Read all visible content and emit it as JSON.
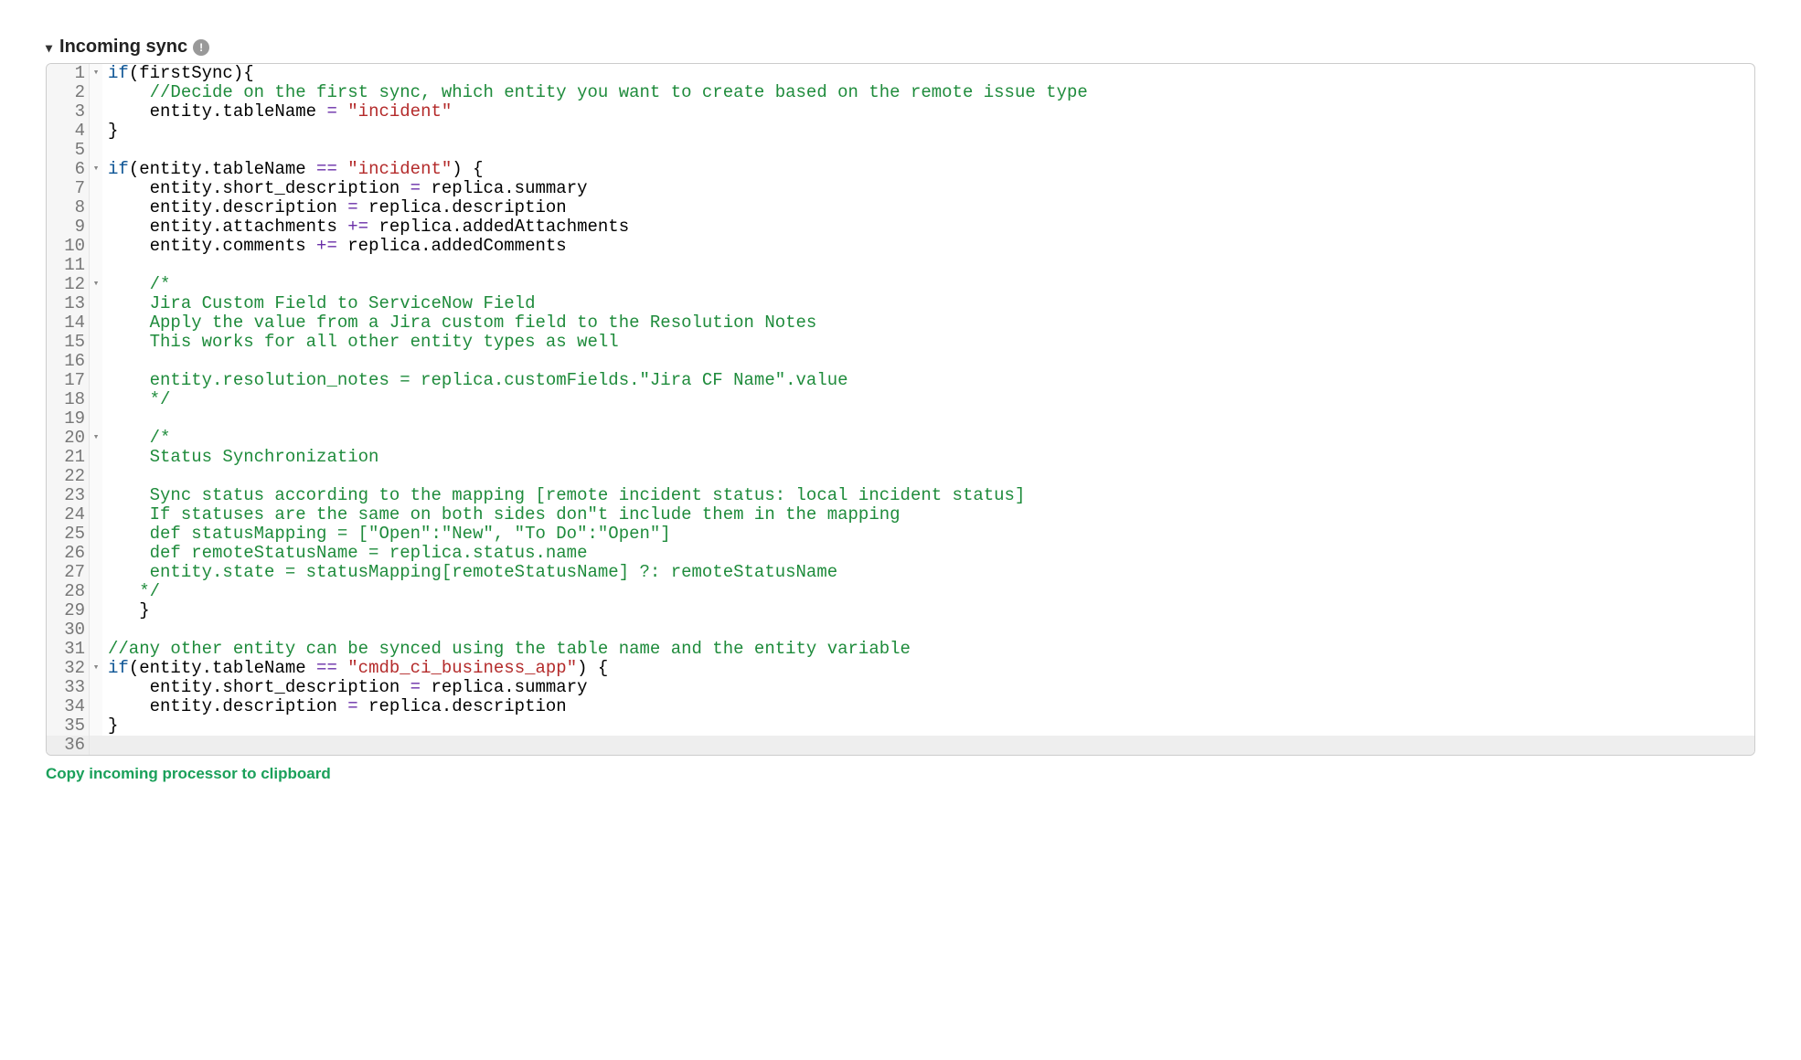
{
  "header": {
    "title": "Incoming sync",
    "info_tooltip": "info"
  },
  "footer": {
    "copy_link": "Copy incoming processor to clipboard"
  },
  "editor": {
    "lines": [
      {
        "n": "1",
        "fold": true,
        "tokens": [
          [
            "kw",
            "if"
          ],
          [
            "def",
            "(firstSync){"
          ]
        ]
      },
      {
        "n": "2",
        "tokens": [
          [
            "indent2"
          ],
          [
            "cm",
            "//Decide on the first sync, which entity you want to create based on the remote issue type"
          ]
        ]
      },
      {
        "n": "3",
        "tokens": [
          [
            "indent2"
          ],
          [
            "def",
            "entity.tableName "
          ],
          [
            "op",
            "="
          ],
          [
            "def",
            " "
          ],
          [
            "str",
            "\"incident\""
          ]
        ]
      },
      {
        "n": "4",
        "tokens": [
          [
            "def",
            "}"
          ]
        ]
      },
      {
        "n": "5",
        "tokens": []
      },
      {
        "n": "6",
        "fold": true,
        "tokens": [
          [
            "kw",
            "if"
          ],
          [
            "def",
            "(entity.tableName "
          ],
          [
            "op",
            "=="
          ],
          [
            "def",
            " "
          ],
          [
            "str",
            "\"incident\""
          ],
          [
            "def",
            ") {"
          ]
        ]
      },
      {
        "n": "7",
        "tokens": [
          [
            "indent2"
          ],
          [
            "def",
            "entity.short_description "
          ],
          [
            "op",
            "="
          ],
          [
            "def",
            " replica.summary"
          ]
        ]
      },
      {
        "n": "8",
        "tokens": [
          [
            "indent2"
          ],
          [
            "def",
            "entity.description "
          ],
          [
            "op",
            "="
          ],
          [
            "def",
            " replica.description"
          ]
        ]
      },
      {
        "n": "9",
        "tokens": [
          [
            "indent2"
          ],
          [
            "def",
            "entity.attachments "
          ],
          [
            "op",
            "+="
          ],
          [
            "def",
            " replica.addedAttachments"
          ]
        ]
      },
      {
        "n": "10",
        "tokens": [
          [
            "indent2"
          ],
          [
            "def",
            "entity.comments "
          ],
          [
            "op",
            "+="
          ],
          [
            "def",
            " replica.addedComments"
          ]
        ]
      },
      {
        "n": "11",
        "tokens": []
      },
      {
        "n": "12",
        "fold": true,
        "tokens": [
          [
            "indent2"
          ],
          [
            "cm",
            "/*"
          ]
        ]
      },
      {
        "n": "13",
        "tokens": [
          [
            "indent2"
          ],
          [
            "cm",
            "Jira Custom Field to ServiceNow Field"
          ]
        ]
      },
      {
        "n": "14",
        "tokens": [
          [
            "indent2"
          ],
          [
            "cm",
            "Apply the value from a Jira custom field to the Resolution Notes"
          ]
        ]
      },
      {
        "n": "15",
        "tokens": [
          [
            "indent2"
          ],
          [
            "cm",
            "This works for all other entity types as well"
          ]
        ]
      },
      {
        "n": "16",
        "tokens": []
      },
      {
        "n": "17",
        "tokens": [
          [
            "indent2"
          ],
          [
            "cm",
            "entity.resolution_notes = replica.customFields.\"Jira CF Name\".value"
          ]
        ]
      },
      {
        "n": "18",
        "tokens": [
          [
            "indent2"
          ],
          [
            "cm",
            "*/"
          ]
        ]
      },
      {
        "n": "19",
        "tokens": []
      },
      {
        "n": "20",
        "fold": true,
        "tokens": [
          [
            "indent2"
          ],
          [
            "cm",
            "/*"
          ]
        ]
      },
      {
        "n": "21",
        "tokens": [
          [
            "indent2"
          ],
          [
            "cm",
            "Status Synchronization"
          ]
        ]
      },
      {
        "n": "22",
        "tokens": []
      },
      {
        "n": "23",
        "tokens": [
          [
            "indent2"
          ],
          [
            "cm",
            "Sync status according to the mapping [remote incident status: local incident status]"
          ]
        ]
      },
      {
        "n": "24",
        "tokens": [
          [
            "indent2"
          ],
          [
            "cm",
            "If statuses are the same on both sides don\"t include them in the mapping"
          ]
        ]
      },
      {
        "n": "25",
        "tokens": [
          [
            "indent2"
          ],
          [
            "cm",
            "def statusMapping = [\"Open\":\"New\", \"To Do\":\"Open\"]"
          ]
        ]
      },
      {
        "n": "26",
        "tokens": [
          [
            "indent2"
          ],
          [
            "cm",
            "def remoteStatusName = replica.status.name"
          ]
        ]
      },
      {
        "n": "27",
        "tokens": [
          [
            "indent2"
          ],
          [
            "cm",
            "entity.state = statusMapping[remoteStatusName] ?: remoteStatusName"
          ]
        ]
      },
      {
        "n": "28",
        "tokens": [
          [
            "indent1"
          ],
          [
            "cm",
            "*/"
          ]
        ]
      },
      {
        "n": "29",
        "tokens": [
          [
            "indent1"
          ],
          [
            "def",
            "}"
          ]
        ]
      },
      {
        "n": "30",
        "tokens": []
      },
      {
        "n": "31",
        "tokens": [
          [
            "cm",
            "//any other entity can be synced using the table name and the entity variable"
          ]
        ]
      },
      {
        "n": "32",
        "fold": true,
        "tokens": [
          [
            "kw",
            "if"
          ],
          [
            "def",
            "(entity.tableName "
          ],
          [
            "op",
            "=="
          ],
          [
            "def",
            " "
          ],
          [
            "str",
            "\"cmdb_ci_business_app\""
          ],
          [
            "def",
            ") {"
          ]
        ]
      },
      {
        "n": "33",
        "tokens": [
          [
            "indent2"
          ],
          [
            "def",
            "entity.short_description "
          ],
          [
            "op",
            "="
          ],
          [
            "def",
            " replica.summary"
          ]
        ]
      },
      {
        "n": "34",
        "tokens": [
          [
            "indent2"
          ],
          [
            "def",
            "entity.description "
          ],
          [
            "op",
            "="
          ],
          [
            "def",
            " replica.description"
          ]
        ]
      },
      {
        "n": "35",
        "tokens": [
          [
            "def",
            "}"
          ]
        ]
      },
      {
        "n": "36",
        "current": true,
        "tokens": []
      }
    ]
  }
}
